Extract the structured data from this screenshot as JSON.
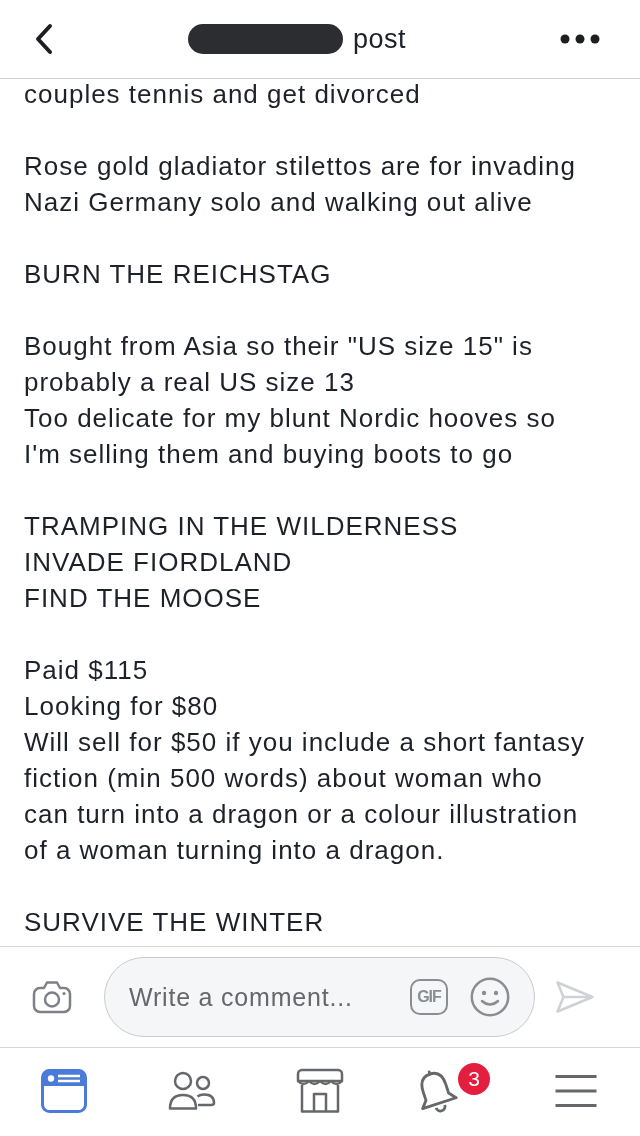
{
  "header": {
    "title": "post"
  },
  "post": {
    "paragraphs": [
      {
        "lines": [
          "couples tennis and get divorced"
        ]
      },
      {
        "lines": [
          "Rose gold gladiator stilettos are for invading",
          "Nazi Germany solo and walking out alive"
        ]
      },
      {
        "lines": [
          "BURN THE REICHSTAG"
        ]
      },
      {
        "lines": [
          "Bought from Asia so their \"US size 15\" is",
          "probably a real US size 13",
          "Too delicate for my blunt Nordic hooves so",
          "I'm selling them and buying boots to go"
        ]
      },
      {
        "lines": [
          "TRAMPING IN THE WILDERNESS",
          "INVADE FIORDLAND",
          "FIND THE MOOSE"
        ]
      },
      {
        "lines": [
          "Paid $115",
          "Looking for $80",
          "Will sell for $50 if you include a short fantasy",
          "fiction (min 500 words) about woman who",
          "can turn into a dragon or a colour illustration",
          "of a woman turning into a dragon."
        ]
      },
      {
        "lines": [
          "SURVIVE THE WINTER"
        ]
      }
    ]
  },
  "comment_bar": {
    "placeholder": "Write a comment...",
    "gif_label": "GIF",
    "send_disabled": true
  },
  "nav": {
    "items": [
      {
        "kind": "news-feed",
        "selected": true
      },
      {
        "kind": "friends",
        "selected": false
      },
      {
        "kind": "marketplace",
        "selected": false
      },
      {
        "kind": "notifications",
        "selected": false,
        "badge": "3"
      },
      {
        "kind": "menu",
        "selected": false
      }
    ]
  }
}
